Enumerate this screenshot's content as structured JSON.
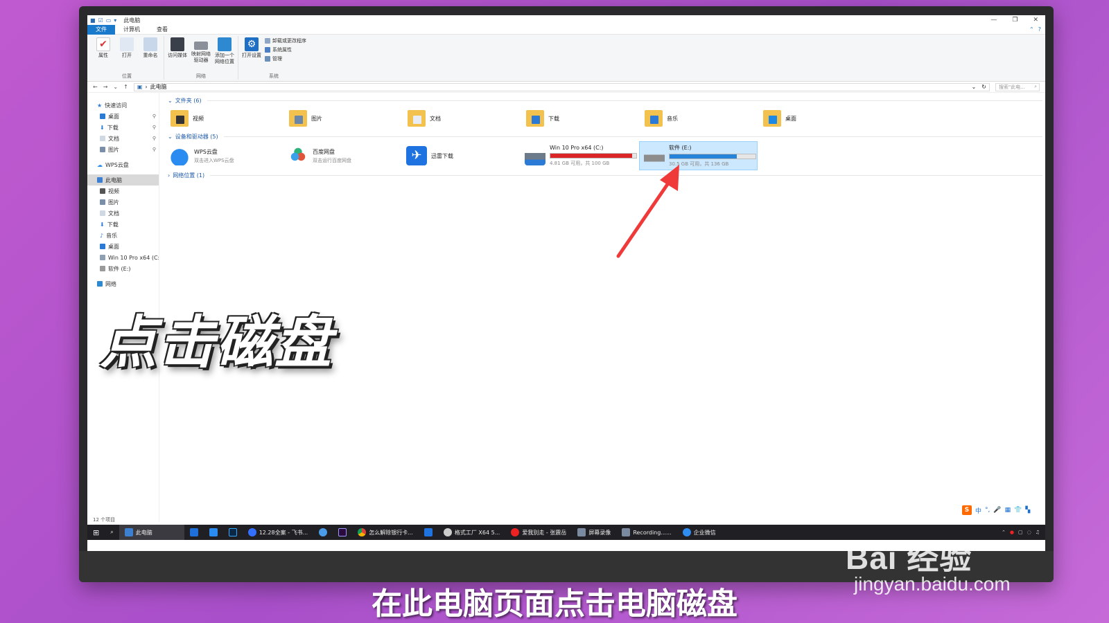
{
  "window": {
    "title": "此电脑",
    "tabs": [
      "文件",
      "计算机",
      "查看"
    ]
  },
  "ribbon": {
    "groups": [
      {
        "label": "位置",
        "items": [
          "属性",
          "打开",
          "重命名"
        ]
      },
      {
        "label": "网络",
        "items": [
          "访问媒体",
          "映射网络驱动器",
          "添加一个网络位置"
        ]
      },
      {
        "label": "系统",
        "items": [
          "打开设置"
        ],
        "small": [
          "卸载或更改程序",
          "系统属性",
          "管理"
        ]
      }
    ]
  },
  "address": {
    "path": "此电脑",
    "search_placeholder": "搜索\"此电..."
  },
  "nav": {
    "quick_access": "快速访问",
    "quick_items": [
      "桌面",
      "下载",
      "文档",
      "图片"
    ],
    "wps": "WPS云盘",
    "this_pc": "此电脑",
    "pc_items": [
      "视频",
      "图片",
      "文档",
      "下载",
      "音乐",
      "桌面",
      "Win 10 Pro x64 (C:",
      "软件 (E:)"
    ],
    "network": "网络"
  },
  "sections": {
    "folders_title": "文件夹 (6)",
    "devices_title": "设备和驱动器 (5)",
    "network_title": "网络位置 (1)"
  },
  "folders": [
    "视频",
    "图片",
    "文档",
    "下载",
    "音乐",
    "桌面"
  ],
  "devices": [
    {
      "name": "WPS云盘",
      "sub": "双击进入WPS云盘",
      "color": "#2a8cf0"
    },
    {
      "name": "百度网盘",
      "sub": "双击运行百度网盘",
      "color": "#3aa0e8"
    },
    {
      "name": "迅雷下载",
      "sub": "",
      "color": "#1f73e0"
    }
  ],
  "drives": [
    {
      "name": "Win 10 Pro x64 (C:)",
      "sub": "4.81 GB 可用，共 100 GB",
      "used_fraction": 0.95,
      "bar_color": "#da2626"
    },
    {
      "name": "软件 (E:)",
      "sub": "30.5 GB 可用，共 136 GB",
      "used_fraction": 0.78,
      "bar_color": "#2683da"
    }
  ],
  "status": {
    "count": "12 个项目"
  },
  "taskbar": {
    "items": [
      "此电脑",
      "12.28全案 - 飞书...",
      "怎么解除银行卡...",
      "格式工厂 X64 5...",
      "爱我别走 - 张震岳",
      "屏幕录像",
      "Recording......",
      "企业微信"
    ],
    "tray_lang": "中"
  },
  "overlay": {
    "caption": "点击磁盘",
    "subtitle": "在此电脑页面点击电脑磁盘",
    "watermark_brand": "Bai  经验",
    "watermark_url": "jingyan.baidu.com"
  },
  "colors": {
    "accent": "#1979ca",
    "arrow": "#f03a3a"
  }
}
